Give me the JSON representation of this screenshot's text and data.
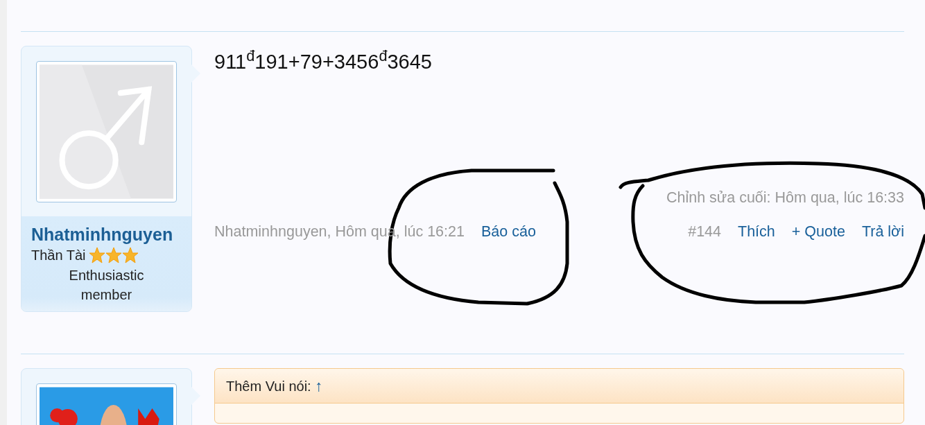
{
  "posts": [
    {
      "user": {
        "name": "Nhatminhnguyen",
        "title": "Thần Tài",
        "stars": 3,
        "rank": "Enthusiastic member",
        "avatar": {
          "kind": "icon"
        }
      },
      "message": "911$^{đ}$191+79+3456$^{đ}$3645",
      "edited": "Chỉnh sửa cuối: Hôm qua, lúc 16:33",
      "author_time": "Nhatminhnguyen, Hôm qua, lúc 16:21",
      "report": "Báo cáo",
      "number": "#144",
      "actions": [
        "Thích",
        "+ Quote",
        "Trả lời"
      ]
    },
    {
      "quote": {
        "author": "Thêm Vui nói:",
        "arrow": "↑"
      }
    }
  ]
}
